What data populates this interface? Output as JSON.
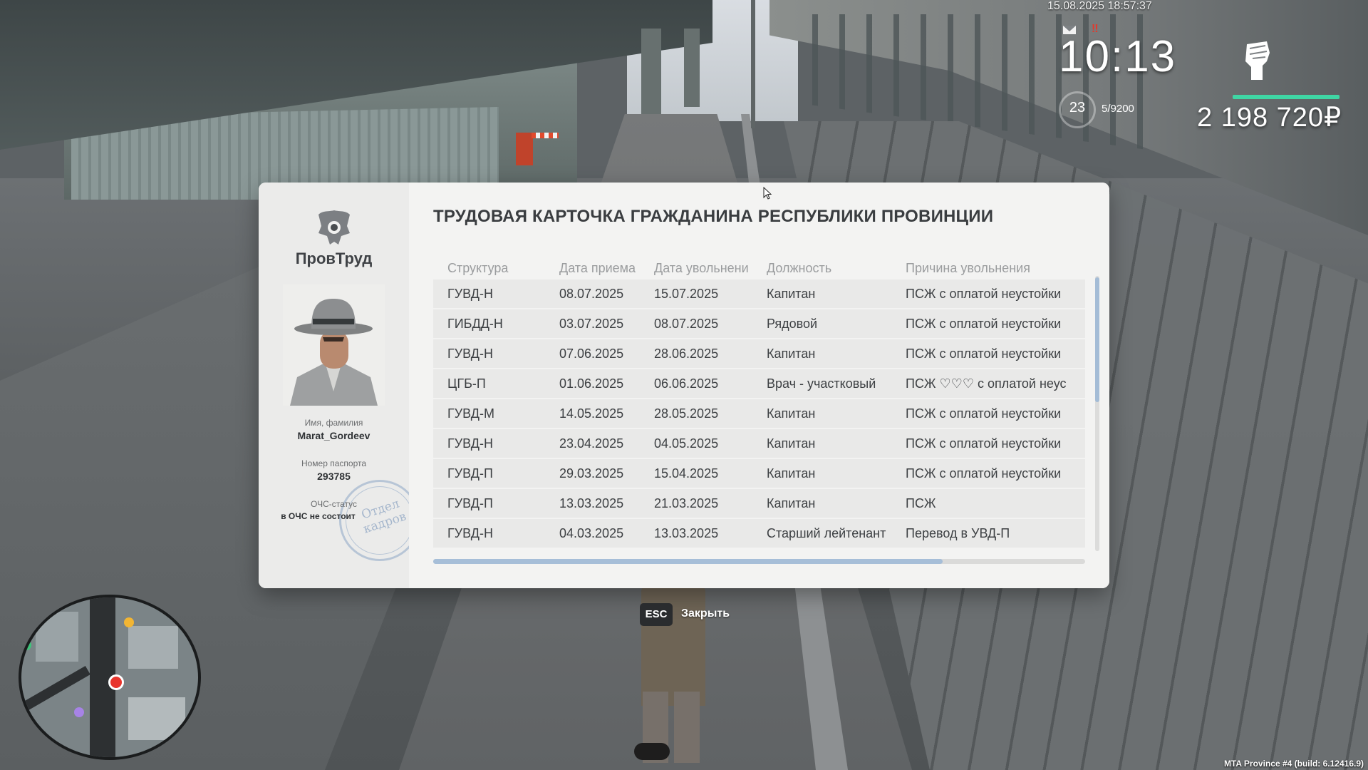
{
  "hud": {
    "datetime": "15.08.2025 18:57:37",
    "clock": "10:13",
    "level": "23",
    "experience": "5/9200",
    "money": "2 198 720₽",
    "alert_icon": "‼",
    "health_fraction": 1.0,
    "health_color": "#3fd6a4",
    "icons": [
      "mail-icon",
      "alert-icon",
      "fist-icon"
    ]
  },
  "card": {
    "title": "ТРУДОВАЯ КАРТОЧКА ГРАЖДАНИНА РЕСПУБЛИКИ ПРОВИНЦИИ",
    "org_name": "ПровТруд",
    "name_label": "Имя, фамилия",
    "name_value": "Marat_Gordeev",
    "passport_label": "Номер паспорта",
    "passport_value": "293785",
    "status_label": "ОЧС-статус",
    "status_value": "в ОЧС не состоит",
    "stamp_text": "Отдел\nкадров",
    "columns": [
      "Структура",
      "Дата приема",
      "Дата увольнени",
      "Должность",
      "Причина увольнения"
    ],
    "rows": [
      [
        "ГУВД-Н",
        "08.07.2025",
        "15.07.2025",
        "Капитан",
        "ПСЖ с оплатой неустойки"
      ],
      [
        "ГИБДД-Н",
        "03.07.2025",
        "08.07.2025",
        "Рядовой",
        "ПСЖ с оплатой неустойки"
      ],
      [
        "ГУВД-Н",
        "07.06.2025",
        "28.06.2025",
        "Капитан",
        "ПСЖ с оплатой неустойки"
      ],
      [
        "ЦГБ-П",
        "01.06.2025",
        "06.06.2025",
        "Врач - участковый",
        "ПСЖ ♡♡♡ с оплатой неус"
      ],
      [
        "ГУВД-М",
        "14.05.2025",
        "28.05.2025",
        "Капитан",
        "ПСЖ с оплатой неустойки"
      ],
      [
        "ГУВД-Н",
        "23.04.2025",
        "04.05.2025",
        "Капитан",
        "ПСЖ с оплатой неустойки"
      ],
      [
        "ГУВД-П",
        "29.03.2025",
        "15.04.2025",
        "Капитан",
        "ПСЖ с оплатой неустойки"
      ],
      [
        "ГУВД-П",
        "13.03.2025",
        "21.03.2025",
        "Капитан",
        "ПСЖ"
      ],
      [
        "ГУВД-Н",
        "04.03.2025",
        "13.03.2025",
        "Старший лейтенант",
        "Перевод в УВД-П"
      ]
    ]
  },
  "close": {
    "key": "ESC",
    "label": "Закрыть"
  },
  "build_info": "MTA Province #4 (build: 6.12416.9)"
}
